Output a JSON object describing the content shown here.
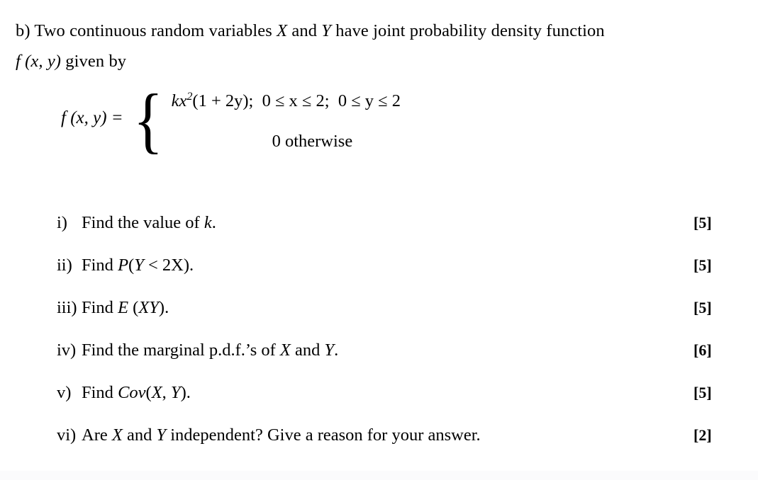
{
  "document": {
    "intro_lines": [
      "b) Two continuous random variables X and Y have joint probability density function",
      "f (x, y) given by"
    ],
    "intro_line_1_pre": "b) Two continuous random variables ",
    "intro_var_x": "X",
    "intro_mid_1": " and ",
    "intro_var_y": "Y",
    "intro_line_1_post": " have joint probability density function",
    "intro_fn": "f (x, y)",
    "intro_line_2_post": " given by",
    "piecewise": {
      "lhs": "f (x, y) =",
      "brace": "{",
      "case_1": "kx²(1 + 2y);  0 ≤ x ≤ 2;  0 ≤ y ≤ 2",
      "case_1_coef": "kx",
      "case_1_exp": "2",
      "case_1_rest": "(1 + 2y);  0 ≤ x ≤ 2;  0 ≤ y ≤ 2",
      "case_2": "0 otherwise"
    },
    "questions": [
      {
        "num": "i)",
        "text": "Find the value of k.",
        "marks": "[5]"
      },
      {
        "num": "ii)",
        "text": "Find P(Y < 2X).",
        "marks": "[5]"
      },
      {
        "num": "iii)",
        "text": "Find E (XY).",
        "marks": "[5]"
      },
      {
        "num": "iv)",
        "text": "Find the marginal p.d.f.’s of X and Y.",
        "marks": "[6]"
      },
      {
        "num": "v)",
        "text": "Find Cov(X, Y).",
        "marks": "[5]"
      },
      {
        "num": "vi)",
        "text": "Are X and Y independent? Give a reason for your answer.",
        "marks": "[2]"
      }
    ],
    "colors": {
      "background": "#ffffff",
      "text": "#000000",
      "bottom_band": "#fbfbfc"
    }
  }
}
